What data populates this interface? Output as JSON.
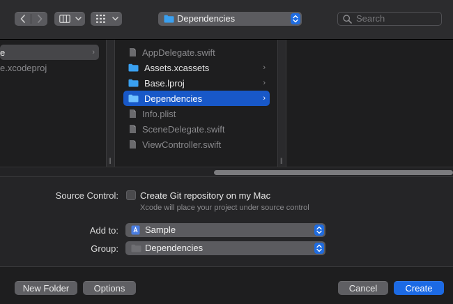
{
  "toolbar": {
    "back_icon": "chevron-left-icon",
    "forward_icon": "chevron-right-icon",
    "view_columns_icon": "columns-view-icon",
    "group_icon": "grid-icon",
    "location_label": "Dependencies",
    "search_placeholder": "Search"
  },
  "browser": {
    "column1": [
      {
        "label": "e",
        "selected": true,
        "has_children": true
      },
      {
        "label": "e.xcodeproj",
        "dim": true
      }
    ],
    "column2": [
      {
        "label": "AppDelegate.swift",
        "kind": "file",
        "dim": true
      },
      {
        "label": "Assets.xcassets",
        "kind": "folder",
        "has_children": true
      },
      {
        "label": "Base.lproj",
        "kind": "folder",
        "has_children": true
      },
      {
        "label": "Dependencies",
        "kind": "folder",
        "has_children": true,
        "selected": true
      },
      {
        "label": "Info.plist",
        "kind": "file",
        "dim": true
      },
      {
        "label": "SceneDelegate.swift",
        "kind": "file",
        "dim": true
      },
      {
        "label": "ViewController.swift",
        "kind": "file",
        "dim": true
      }
    ]
  },
  "form": {
    "source_control_label": "Source Control:",
    "git_checkbox_label": "Create Git repository on my Mac",
    "git_checked": false,
    "git_hint": "Xcode will place your project under source control",
    "add_to_label": "Add to:",
    "add_to_value": "Sample",
    "group_label": "Group:",
    "group_value": "Dependencies"
  },
  "footer": {
    "new_folder": "New Folder",
    "options": "Options",
    "cancel": "Cancel",
    "create": "Create"
  },
  "colors": {
    "accent": "#1c6ae4",
    "selection": "#1858c8",
    "folder": "#3aa0f0"
  }
}
